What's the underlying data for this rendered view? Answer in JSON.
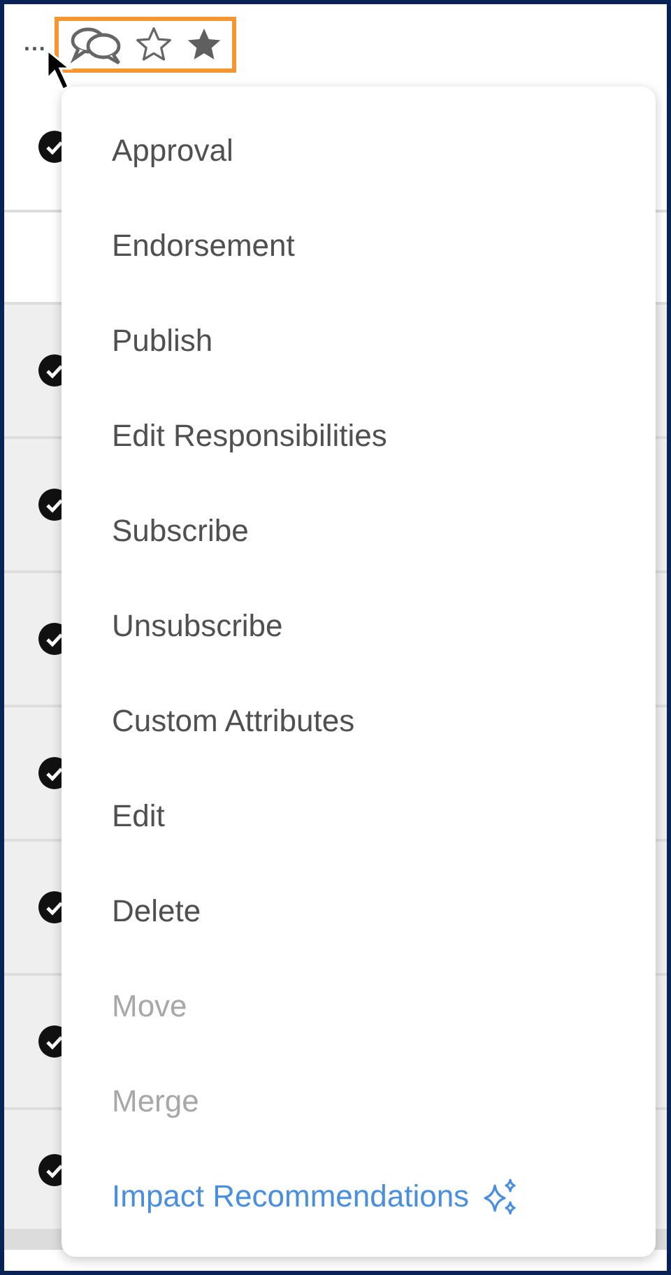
{
  "toolbar": {
    "more": "..."
  },
  "rows": [
    {
      "checked": true,
      "selected": false
    },
    {
      "checked": false,
      "selected": false
    },
    {
      "checked": true,
      "selected": true
    },
    {
      "checked": true,
      "selected": true
    },
    {
      "checked": true,
      "selected": true
    },
    {
      "checked": true,
      "selected": true
    },
    {
      "checked": true,
      "selected": true
    },
    {
      "checked": true,
      "selected": true
    },
    {
      "checked": true,
      "selected": true
    }
  ],
  "menu": {
    "items": [
      {
        "label": "Approval",
        "kind": "action",
        "disabled": false
      },
      {
        "label": "Endorsement",
        "kind": "action",
        "disabled": false
      },
      {
        "label": "Publish",
        "kind": "action",
        "disabled": false
      },
      {
        "label": "Edit Responsibilities",
        "kind": "action",
        "disabled": false
      },
      {
        "label": "Subscribe",
        "kind": "action",
        "disabled": false
      },
      {
        "label": "Unsubscribe",
        "kind": "action",
        "disabled": false
      },
      {
        "label": "Custom Attributes",
        "kind": "action",
        "disabled": false
      },
      {
        "label": "Edit",
        "kind": "action",
        "disabled": false
      },
      {
        "label": "Delete",
        "kind": "action",
        "disabled": false
      },
      {
        "label": "Move",
        "kind": "action",
        "disabled": true
      },
      {
        "label": "Merge",
        "kind": "action",
        "disabled": true
      },
      {
        "label": "Impact Recommendations",
        "kind": "ai",
        "disabled": false
      }
    ]
  }
}
